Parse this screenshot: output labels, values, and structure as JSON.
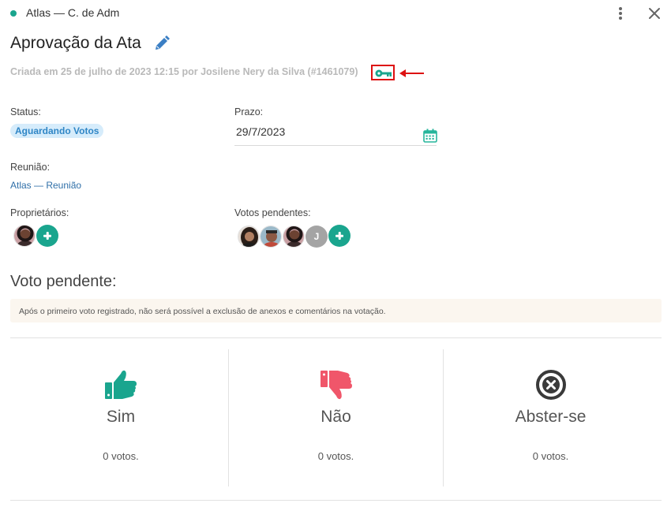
{
  "header": {
    "title": "Atlas — C. de Adm",
    "status_dot_color": "#1aa58e"
  },
  "page": {
    "title": "Aprovação da Ata",
    "created_line": "Criada em 25 de julho de 2023 12:15 por Josilene Nery da Silva (#1461079)"
  },
  "status": {
    "label": "Status:",
    "value": "Aguardando Votos"
  },
  "deadline": {
    "label": "Prazo:",
    "value": "29/7/2023"
  },
  "meeting": {
    "label": "Reunião:",
    "link": "Atlas — Reunião"
  },
  "owners": {
    "label": "Proprietários:"
  },
  "pending_votes": {
    "label": "Votos pendentes:",
    "letter_avatar": "J"
  },
  "vote_section": {
    "title": "Voto pendente:",
    "notice": "Após o primeiro voto registrado, não será possível a exclusão de anexos e comentários na votação.",
    "options": [
      {
        "label": "Sim",
        "count": "0 votos.",
        "icon": "thumbs-up-icon",
        "color": "#1aa58e"
      },
      {
        "label": "Não",
        "count": "0 votos.",
        "icon": "thumbs-down-icon",
        "color": "#f0566a"
      },
      {
        "label": "Abster-se",
        "count": "0 votos.",
        "icon": "abstain-icon",
        "color": "#3a3a3a"
      }
    ]
  },
  "colors": {
    "accent": "#1aa58e",
    "link": "#2f6fa8",
    "badge_bg": "#d6ecfb",
    "badge_text": "#2f86c6",
    "annotation_red": "#d11111"
  }
}
